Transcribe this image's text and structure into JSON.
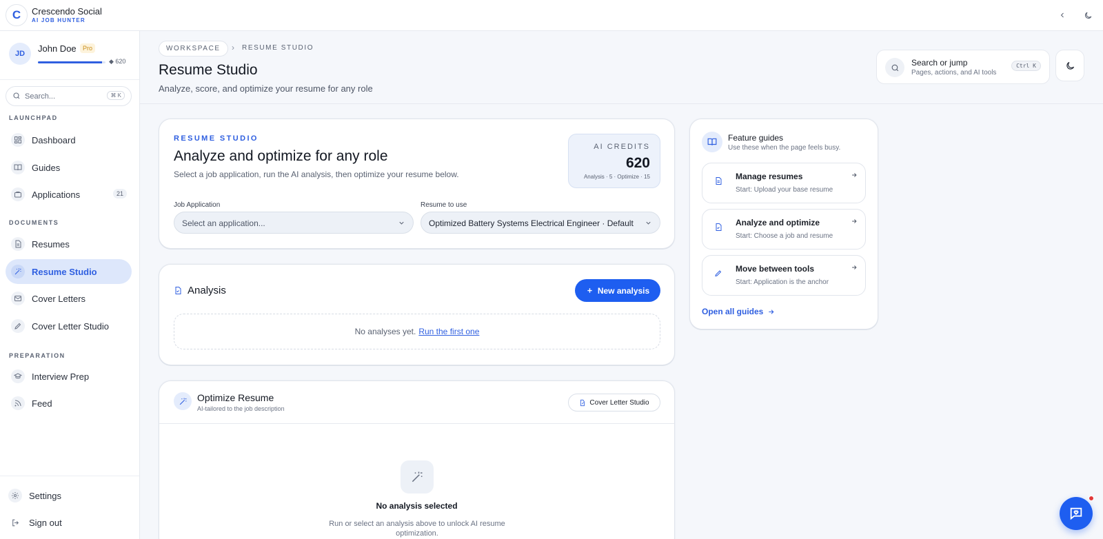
{
  "app": {
    "name": "Crescendo Social",
    "tagline": "AI JOB HUNTER",
    "logo_letter": "C",
    "accent": "#2f5fe0",
    "primary_button_color": "#1e5ef0"
  },
  "user": {
    "initials": "JD",
    "name": "John Doe",
    "plan": "Pro",
    "credits": "620",
    "credit_fraction": 0.95
  },
  "sidebar": {
    "search_placeholder": "Search...",
    "search_shortcut": "⌘ K",
    "sections": [
      {
        "label": "LAUNCHPAD",
        "items": [
          {
            "label": "Dashboard",
            "icon": "dashboard-icon"
          },
          {
            "label": "Guides",
            "icon": "book-icon"
          },
          {
            "label": "Applications",
            "icon": "briefcase-icon",
            "count": "21"
          }
        ]
      },
      {
        "label": "DOCUMENTS",
        "items": [
          {
            "label": "Resumes",
            "icon": "document-icon"
          },
          {
            "label": "Resume Studio",
            "icon": "magic-wand-icon",
            "active": true
          },
          {
            "label": "Cover Letters",
            "icon": "mail-icon"
          },
          {
            "label": "Cover Letter Studio",
            "icon": "pen-icon"
          }
        ]
      },
      {
        "label": "PREPARATION",
        "items": [
          {
            "label": "Interview Prep",
            "icon": "graduation-cap-icon"
          },
          {
            "label": "Feed",
            "icon": "rss-icon"
          }
        ]
      }
    ],
    "footer": [
      {
        "label": "Settings",
        "icon": "gear-icon"
      },
      {
        "label": "Sign out",
        "icon": "sign-out-icon"
      }
    ]
  },
  "header": {
    "breadcrumb_root": "WORKSPACE",
    "breadcrumb_current": "RESUME STUDIO",
    "title": "Resume Studio",
    "subtitle": "Analyze, score, and optimize your resume for any role",
    "jump_title": "Search or jump",
    "jump_sub": "Pages, actions, and AI tools",
    "jump_shortcut": "Ctrl K"
  },
  "studio_card": {
    "eyebrow": "RESUME STUDIO",
    "heading": "Analyze and optimize for any role",
    "description": "Select a job application, run the AI analysis, then optimize your resume below.",
    "credits_label": "AI CREDITS",
    "credits_value": "620",
    "credits_meta": "Analysis · 5 · Optimize · 15",
    "job_label": "Job Application",
    "job_placeholder": "Select an application...",
    "resume_label": "Resume to use",
    "resume_value": "Optimized Battery Systems Electrical Engineer · Default"
  },
  "analysis_card": {
    "title": "Analysis",
    "new_button": "New analysis",
    "empty_text": "No analyses yet.",
    "empty_link": "Run the first one"
  },
  "optimize_card": {
    "title": "Optimize Resume",
    "subtitle": "AI-tailored to the job description",
    "cover_button": "Cover Letter Studio",
    "empty_title": "No analysis selected",
    "empty_text": "Run or select an analysis above to unlock AI resume optimization."
  },
  "guides": {
    "title": "Feature guides",
    "subtitle": "Use these when the page feels busy.",
    "items": [
      {
        "title": "Manage resumes",
        "sub": "Start: Upload your base resume",
        "icon": "document-icon"
      },
      {
        "title": "Analyze and optimize",
        "sub": "Start: Choose a job and resume",
        "icon": "document-check-icon"
      },
      {
        "title": "Move between tools",
        "sub": "Start: Application is the anchor",
        "icon": "pen-icon"
      }
    ],
    "link": "Open all guides"
  }
}
